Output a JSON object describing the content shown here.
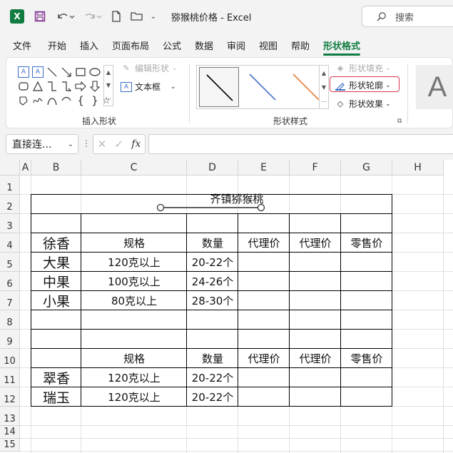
{
  "window": {
    "app_icon_letter": "X",
    "title": "猕猴桃价格  -  Excel",
    "search_placeholder": "搜索"
  },
  "menu": {
    "tabs": [
      "文件",
      "开始",
      "插入",
      "页面布局",
      "公式",
      "数据",
      "审阅",
      "视图",
      "帮助",
      "形状格式"
    ],
    "active_tab": "形状格式"
  },
  "ribbon": {
    "edit_shape_label": "编辑形状",
    "textbox_label": "文本框",
    "insert_shapes_group": "插入形状",
    "shape_styles_group": "形状样式",
    "shape_fill_label": "形状填充",
    "shape_outline_label": "形状轮廓",
    "shape_effects_label": "形状效果",
    "wordart_letter": "A"
  },
  "formula_bar": {
    "name_box": "直接连...",
    "formula": ""
  },
  "sheet": {
    "columns": [
      "A",
      "B",
      "C",
      "D",
      "E",
      "F",
      "G",
      "H"
    ],
    "rows": [
      "1",
      "2",
      "3",
      "4",
      "5",
      "6",
      "7",
      "8",
      "9",
      "10",
      "11",
      "12",
      "13",
      "14",
      "15"
    ],
    "title_cell": "齐镇猕猴桃",
    "table1": {
      "headers": [
        "徐香",
        "规格",
        "数量",
        "代理价",
        "代理价",
        "零售价"
      ],
      "rows": [
        [
          "大果",
          "120克以上",
          "20-22个"
        ],
        [
          "中果",
          "100克以上",
          "24-26个"
        ],
        [
          "小果",
          "80克以上",
          "28-30个"
        ]
      ]
    },
    "table2": {
      "headers": [
        "",
        "规格",
        "数量",
        "代理价",
        "代理价",
        "零售价"
      ],
      "rows": [
        [
          "翠香",
          "120克以上",
          "20-22个"
        ],
        [
          "瑞玉",
          "120克以上",
          "20-22个"
        ]
      ]
    }
  },
  "colors": {
    "accent": "#107c41",
    "outline_highlight": "#d9344b",
    "blue_line": "#4472c4",
    "orange_line": "#ed7d31"
  }
}
